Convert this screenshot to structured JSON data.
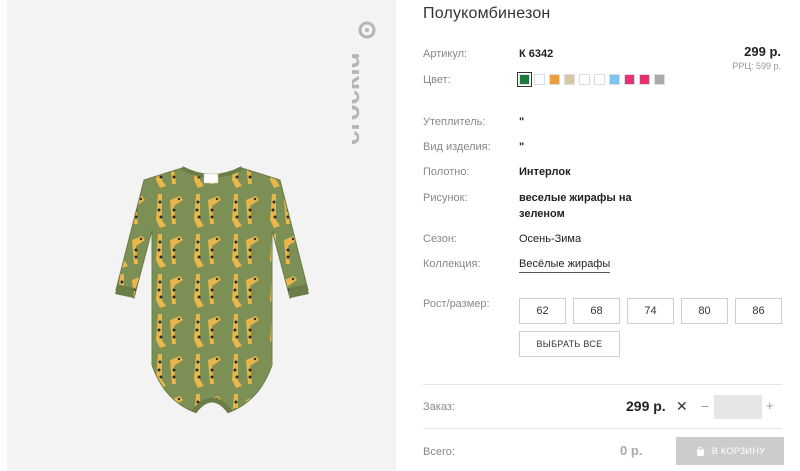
{
  "brand": {
    "name": "crockid"
  },
  "product": {
    "title": "Полукомбинезон",
    "price": "299 р.",
    "rrp": "РРЦ: 599 р."
  },
  "specs": {
    "article": {
      "label": "Артикул:",
      "value": "К 6342"
    },
    "color": {
      "label": "Цвет:"
    },
    "insulation": {
      "label": "Утеплитель:",
      "value": "\""
    },
    "item_type": {
      "label": "Вид изделия:",
      "value": "\""
    },
    "fabric": {
      "label": "Полотно:",
      "value": "Интерлок"
    },
    "pattern": {
      "label": "Рисунок:",
      "value_line1": "веселые жирафы на",
      "value_line2": "зеленом"
    },
    "season": {
      "label": "Сезон:",
      "value": "Осень-Зима"
    },
    "collection": {
      "label": "Коллекция:",
      "value": "Весёлые жирафы"
    }
  },
  "swatches": [
    {
      "color": "#1e7a3a",
      "selected": true
    },
    {
      "color": "#ffffff"
    },
    {
      "color": "#e9a03c"
    },
    {
      "color": "#d8c8a4"
    },
    {
      "color": "#ffffff"
    },
    {
      "color": "#ffffff"
    },
    {
      "color": "#7fc4ee"
    },
    {
      "color": "#e8317a"
    },
    {
      "color": "#e5306e"
    },
    {
      "color": "#aaaaaa"
    }
  ],
  "sizes": {
    "label": "Рост/размер:",
    "options": [
      "62",
      "68",
      "74",
      "80",
      "86"
    ],
    "select_all": "ВЫБРАТЬ ВСЕ"
  },
  "order": {
    "label": "Заказ:",
    "price": "299 р.",
    "times": "✕",
    "minus": "−",
    "plus": "+",
    "quantity": ""
  },
  "total": {
    "label": "Всего:",
    "value": "0 р.",
    "cart_button": "В КОРЗИНУ"
  }
}
